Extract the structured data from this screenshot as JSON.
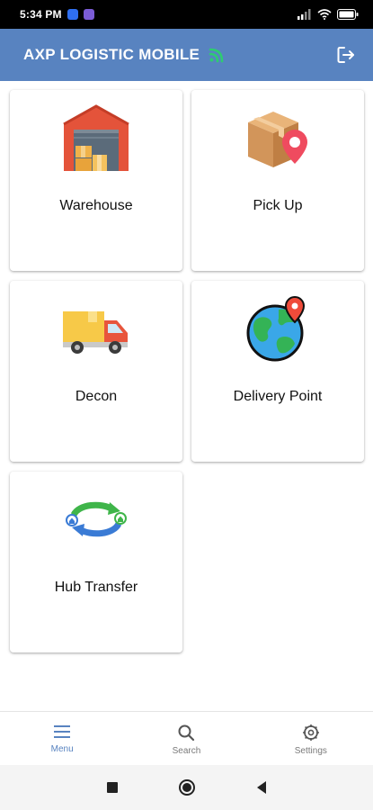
{
  "status_bar": {
    "time": "5:34 PM"
  },
  "app_bar": {
    "title": "AXP LOGISTIC MOBILE"
  },
  "menu": {
    "items": [
      {
        "label": "Warehouse",
        "icon": "warehouse-icon"
      },
      {
        "label": "Pick Up",
        "icon": "package-pin-icon"
      },
      {
        "label": "Decon",
        "icon": "delivery-truck-icon"
      },
      {
        "label": "Delivery Point",
        "icon": "globe-pin-icon"
      },
      {
        "label": "Hub Transfer",
        "icon": "transfer-arrows-icon"
      }
    ]
  },
  "bottom_nav": {
    "items": [
      {
        "label": "Menu",
        "icon": "menu-icon",
        "active": true
      },
      {
        "label": "Search",
        "icon": "search-icon",
        "active": false
      },
      {
        "label": "Settings",
        "icon": "settings-icon",
        "active": false
      }
    ]
  },
  "colors": {
    "app_bar": "#5883c0",
    "signal_green": "#2ecc71",
    "active_nav": "#5883c0"
  }
}
